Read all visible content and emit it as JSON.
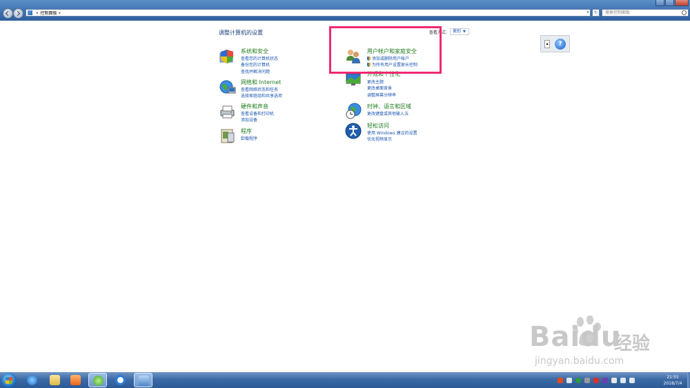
{
  "window": {
    "breadcrumb": "控制面板",
    "search_placeholder": "搜索控制面板"
  },
  "main": {
    "heading": "调整计算机的设置",
    "view_by_label": "查看方式:",
    "view_by_value": "类别"
  },
  "categories": [
    {
      "title": "系统和安全",
      "links": [
        "查看您的计算机状态",
        "备份您的计算机",
        "查找并解决问题"
      ]
    },
    {
      "title": "网络和 Internet",
      "links": [
        "查看网络状态和任务",
        "选择家庭组和共享选项"
      ]
    },
    {
      "title": "硬件和声音",
      "links": [
        "查看设备和打印机",
        "添加设备"
      ]
    },
    {
      "title": "程序",
      "links": [
        "卸载程序"
      ]
    },
    {
      "title": "用户帐户和家庭安全",
      "links": [
        "添加或删除用户帐户",
        "为所有用户设置家长控制"
      ]
    },
    {
      "title": "外观和个性化",
      "links": [
        "更改主题",
        "更改桌面背景",
        "调整屏幕分辨率"
      ]
    },
    {
      "title": "时钟、语言和区域",
      "links": [
        "更改键盘或其他输入法"
      ]
    },
    {
      "title": "轻松访问",
      "links": [
        "使用 Windows 建议的设置",
        "优化视频显示"
      ]
    }
  ],
  "taskbar": {
    "time": "21:55",
    "date": "2018/7/4"
  },
  "watermark": {
    "brand": "Baidu",
    "cn": "经验",
    "url": "jingyan.baidu.com"
  },
  "colors": {
    "highlight": "#ef2870",
    "category_title": "#1e7b1e",
    "link": "#1a55b0"
  }
}
